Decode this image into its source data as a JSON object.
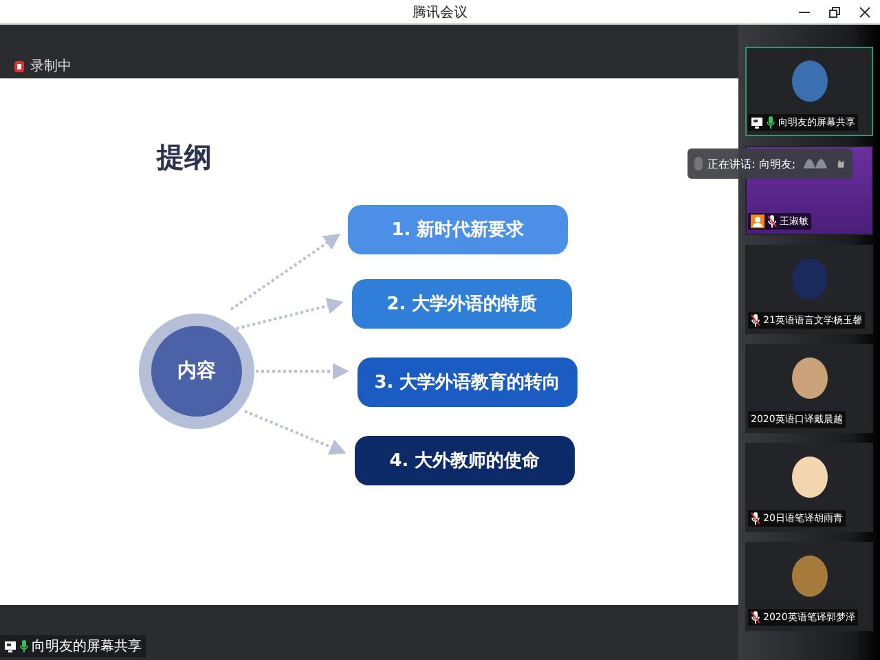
{
  "window": {
    "title": "腾讯会议"
  },
  "recording": {
    "label": "录制中"
  },
  "slide": {
    "title": "提纲",
    "center": "内容",
    "items": [
      {
        "label": "1.  新时代新要求",
        "color": "#4b8fe6"
      },
      {
        "label": "2. 大学外语的特质",
        "color": "#2f7fd8"
      },
      {
        "label": "3. 大学外语教育的转向",
        "color": "#1b5cc2"
      },
      {
        "label": "4. 大外教师的使命",
        "color": "#0d2a68"
      }
    ]
  },
  "share_label": "向明友的屏幕共享",
  "speaking": {
    "label": "正在讲话: 向明友;"
  },
  "participants": [
    {
      "name": "向明友的屏幕共享",
      "kind": "avatar",
      "host": false,
      "sharing": true,
      "mic": true,
      "muted": false,
      "selected": true
    },
    {
      "name": "王淑敏",
      "kind": "video",
      "host": true,
      "sharing": false,
      "mic": true,
      "muted": true,
      "selected": false
    },
    {
      "name": "21英语语言文学杨玉馨",
      "kind": "avatar",
      "host": false,
      "sharing": false,
      "mic": true,
      "muted": true,
      "selected": false
    },
    {
      "name": "2020英语口译戴晨越",
      "kind": "avatar",
      "host": false,
      "sharing": false,
      "mic": false,
      "selected": false
    },
    {
      "name": "20日语笔译胡雨青",
      "kind": "avatar",
      "host": false,
      "sharing": false,
      "mic": true,
      "muted": true,
      "selected": false
    },
    {
      "name": "2020英语笔译郭梦泽",
      "kind": "avatar",
      "host": false,
      "sharing": false,
      "mic": true,
      "muted": true,
      "selected": false
    }
  ]
}
